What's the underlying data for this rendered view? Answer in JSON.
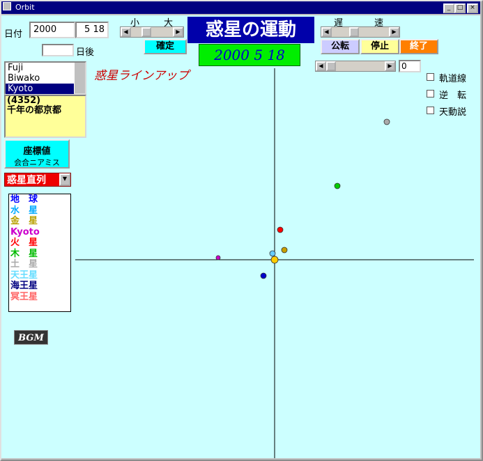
{
  "window": {
    "title": "Orbit",
    "min": "_",
    "max": "□",
    "close": "×"
  },
  "date": {
    "label": "日付",
    "year": "2000",
    "monthday": "5 18",
    "days_after_value": "",
    "days_after_label": "日後"
  },
  "scale": {
    "small": "小",
    "large": "大",
    "confirm": "確定"
  },
  "title": "惑星の運動",
  "display_date": "2000 5 18",
  "speed": {
    "slow": "遅",
    "fast": "速",
    "revolve": "公転",
    "stop": "停止",
    "exit": "終了",
    "value": "0"
  },
  "lineup_title": "惑星ラインアップ",
  "locations": [
    "Fuji",
    "Biwako",
    "Kyoto"
  ],
  "selected_location": "Kyoto",
  "memo": "(4352)\n千年の都京都",
  "coord_button": {
    "line1": "座標値",
    "line2": "会合ニアミス"
  },
  "mode_select": "惑星直列",
  "checkboxes": [
    "軌道線",
    "逆　転",
    "天動説"
  ],
  "legend": [
    {
      "name": "地　球",
      "color": "#0000ff"
    },
    {
      "name": "水　星",
      "color": "#00aaff"
    },
    {
      "name": "金　星",
      "color": "#b8a000"
    },
    {
      "name": "Kyoto",
      "color": "#cc00cc"
    },
    {
      "name": "火　星",
      "color": "#ff0000"
    },
    {
      "name": "木　星",
      "color": "#00bb00"
    },
    {
      "name": "土　星",
      "color": "#aaaaaa"
    },
    {
      "name": "天王星",
      "color": "#66ddff"
    },
    {
      "name": "海王星",
      "color": "#000080"
    },
    {
      "name": "冥王星",
      "color": "#ff6666"
    }
  ],
  "bgm_label": "BGM",
  "planets": [
    {
      "name": "Sun",
      "color": "#ffcc00"
    },
    {
      "name": "Mercury",
      "color": "#66ccff"
    },
    {
      "name": "Venus",
      "color": "#c8a000"
    },
    {
      "name": "Mars",
      "color": "#ff0000"
    },
    {
      "name": "Earth",
      "color": "#0000cc"
    },
    {
      "name": "Jupiter",
      "color": "#00cc00"
    },
    {
      "name": "Saturn",
      "color": "#aaaaaa"
    },
    {
      "name": "Kyoto",
      "color": "#cc00cc"
    }
  ]
}
